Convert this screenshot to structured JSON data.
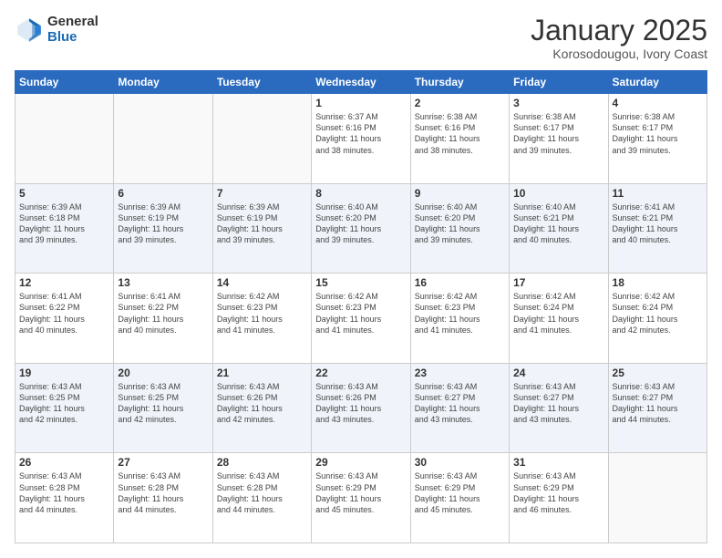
{
  "header": {
    "logo_general": "General",
    "logo_blue": "Blue",
    "month_title": "January 2025",
    "location": "Korosodougou, Ivory Coast"
  },
  "days_of_week": [
    "Sunday",
    "Monday",
    "Tuesday",
    "Wednesday",
    "Thursday",
    "Friday",
    "Saturday"
  ],
  "weeks": [
    [
      {
        "day": "",
        "info": ""
      },
      {
        "day": "",
        "info": ""
      },
      {
        "day": "",
        "info": ""
      },
      {
        "day": "1",
        "info": "Sunrise: 6:37 AM\nSunset: 6:16 PM\nDaylight: 11 hours\nand 38 minutes."
      },
      {
        "day": "2",
        "info": "Sunrise: 6:38 AM\nSunset: 6:16 PM\nDaylight: 11 hours\nand 38 minutes."
      },
      {
        "day": "3",
        "info": "Sunrise: 6:38 AM\nSunset: 6:17 PM\nDaylight: 11 hours\nand 39 minutes."
      },
      {
        "day": "4",
        "info": "Sunrise: 6:38 AM\nSunset: 6:17 PM\nDaylight: 11 hours\nand 39 minutes."
      }
    ],
    [
      {
        "day": "5",
        "info": "Sunrise: 6:39 AM\nSunset: 6:18 PM\nDaylight: 11 hours\nand 39 minutes."
      },
      {
        "day": "6",
        "info": "Sunrise: 6:39 AM\nSunset: 6:19 PM\nDaylight: 11 hours\nand 39 minutes."
      },
      {
        "day": "7",
        "info": "Sunrise: 6:39 AM\nSunset: 6:19 PM\nDaylight: 11 hours\nand 39 minutes."
      },
      {
        "day": "8",
        "info": "Sunrise: 6:40 AM\nSunset: 6:20 PM\nDaylight: 11 hours\nand 39 minutes."
      },
      {
        "day": "9",
        "info": "Sunrise: 6:40 AM\nSunset: 6:20 PM\nDaylight: 11 hours\nand 39 minutes."
      },
      {
        "day": "10",
        "info": "Sunrise: 6:40 AM\nSunset: 6:21 PM\nDaylight: 11 hours\nand 40 minutes."
      },
      {
        "day": "11",
        "info": "Sunrise: 6:41 AM\nSunset: 6:21 PM\nDaylight: 11 hours\nand 40 minutes."
      }
    ],
    [
      {
        "day": "12",
        "info": "Sunrise: 6:41 AM\nSunset: 6:22 PM\nDaylight: 11 hours\nand 40 minutes."
      },
      {
        "day": "13",
        "info": "Sunrise: 6:41 AM\nSunset: 6:22 PM\nDaylight: 11 hours\nand 40 minutes."
      },
      {
        "day": "14",
        "info": "Sunrise: 6:42 AM\nSunset: 6:23 PM\nDaylight: 11 hours\nand 41 minutes."
      },
      {
        "day": "15",
        "info": "Sunrise: 6:42 AM\nSunset: 6:23 PM\nDaylight: 11 hours\nand 41 minutes."
      },
      {
        "day": "16",
        "info": "Sunrise: 6:42 AM\nSunset: 6:23 PM\nDaylight: 11 hours\nand 41 minutes."
      },
      {
        "day": "17",
        "info": "Sunrise: 6:42 AM\nSunset: 6:24 PM\nDaylight: 11 hours\nand 41 minutes."
      },
      {
        "day": "18",
        "info": "Sunrise: 6:42 AM\nSunset: 6:24 PM\nDaylight: 11 hours\nand 42 minutes."
      }
    ],
    [
      {
        "day": "19",
        "info": "Sunrise: 6:43 AM\nSunset: 6:25 PM\nDaylight: 11 hours\nand 42 minutes."
      },
      {
        "day": "20",
        "info": "Sunrise: 6:43 AM\nSunset: 6:25 PM\nDaylight: 11 hours\nand 42 minutes."
      },
      {
        "day": "21",
        "info": "Sunrise: 6:43 AM\nSunset: 6:26 PM\nDaylight: 11 hours\nand 42 minutes."
      },
      {
        "day": "22",
        "info": "Sunrise: 6:43 AM\nSunset: 6:26 PM\nDaylight: 11 hours\nand 43 minutes."
      },
      {
        "day": "23",
        "info": "Sunrise: 6:43 AM\nSunset: 6:27 PM\nDaylight: 11 hours\nand 43 minutes."
      },
      {
        "day": "24",
        "info": "Sunrise: 6:43 AM\nSunset: 6:27 PM\nDaylight: 11 hours\nand 43 minutes."
      },
      {
        "day": "25",
        "info": "Sunrise: 6:43 AM\nSunset: 6:27 PM\nDaylight: 11 hours\nand 44 minutes."
      }
    ],
    [
      {
        "day": "26",
        "info": "Sunrise: 6:43 AM\nSunset: 6:28 PM\nDaylight: 11 hours\nand 44 minutes."
      },
      {
        "day": "27",
        "info": "Sunrise: 6:43 AM\nSunset: 6:28 PM\nDaylight: 11 hours\nand 44 minutes."
      },
      {
        "day": "28",
        "info": "Sunrise: 6:43 AM\nSunset: 6:28 PM\nDaylight: 11 hours\nand 44 minutes."
      },
      {
        "day": "29",
        "info": "Sunrise: 6:43 AM\nSunset: 6:29 PM\nDaylight: 11 hours\nand 45 minutes."
      },
      {
        "day": "30",
        "info": "Sunrise: 6:43 AM\nSunset: 6:29 PM\nDaylight: 11 hours\nand 45 minutes."
      },
      {
        "day": "31",
        "info": "Sunrise: 6:43 AM\nSunset: 6:29 PM\nDaylight: 11 hours\nand 46 minutes."
      },
      {
        "day": "",
        "info": ""
      }
    ]
  ]
}
